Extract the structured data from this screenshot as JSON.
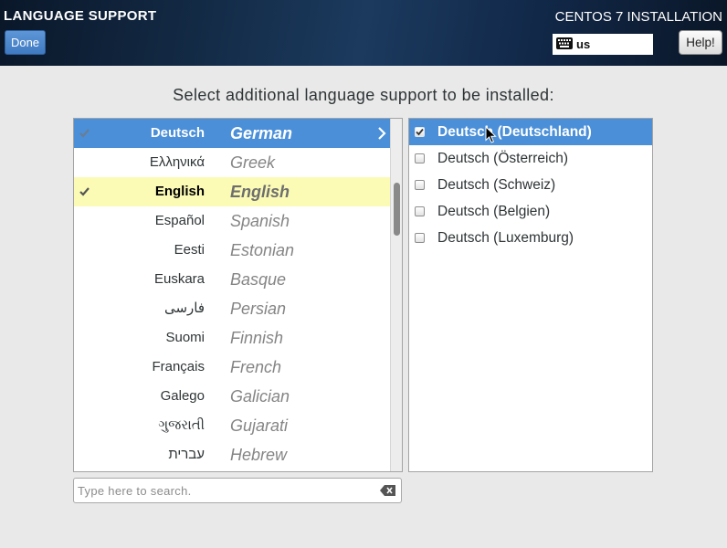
{
  "header": {
    "title": "LANGUAGE SUPPORT",
    "done_label": "Done",
    "product_title": "CENTOS 7 INSTALLATION",
    "keyboard": {
      "icon": "keyboard-icon",
      "layout": "us"
    },
    "help_label": "Help!"
  },
  "main": {
    "prompt": "Select additional language support to be installed:",
    "languages": [
      {
        "native": "Deutsch",
        "english": "German",
        "selected": true,
        "checked": true
      },
      {
        "native": "Ελληνικά",
        "english": "Greek"
      },
      {
        "native": "English",
        "english": "English",
        "highlighted": true,
        "checked": true
      },
      {
        "native": "Español",
        "english": "Spanish"
      },
      {
        "native": "Eesti",
        "english": "Estonian"
      },
      {
        "native": "Euskara",
        "english": "Basque"
      },
      {
        "native": "فارسی",
        "english": "Persian"
      },
      {
        "native": "Suomi",
        "english": "Finnish"
      },
      {
        "native": "Français",
        "english": "French"
      },
      {
        "native": "Galego",
        "english": "Galician"
      },
      {
        "native": "ગુજરાતી",
        "english": "Gujarati"
      },
      {
        "native": "עברית",
        "english": "Hebrew"
      }
    ],
    "locales": [
      {
        "label": "Deutsch (Deutschland)",
        "checked": true,
        "selected": true
      },
      {
        "label": "Deutsch (Österreich)",
        "checked": false
      },
      {
        "label": "Deutsch (Schweiz)",
        "checked": false
      },
      {
        "label": "Deutsch (Belgien)",
        "checked": false
      },
      {
        "label": "Deutsch (Luxemburg)",
        "checked": false
      }
    ],
    "search": {
      "placeholder": "Type here to search.",
      "value": ""
    }
  },
  "icons": {
    "check": "check-icon",
    "chevron": "chevron-right-icon",
    "checkbox": "checkbox-icon",
    "clear": "clear-text-icon",
    "cursor": "mouse-cursor-icon"
  },
  "colors": {
    "background": "#e9e9e9",
    "header": "#142c48",
    "selection": "#4a8fd8",
    "row_highlight": "#fbfbb6"
  }
}
